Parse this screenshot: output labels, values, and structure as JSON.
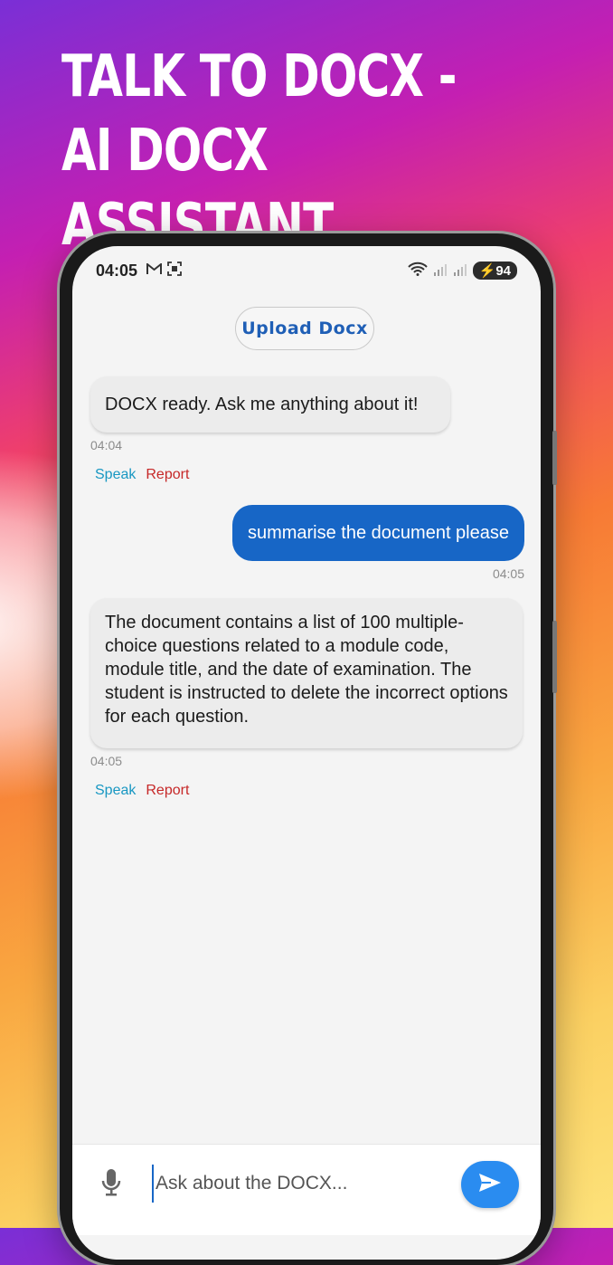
{
  "promo": {
    "title_line1": "TALK TO DOCX -",
    "title_line2": "AI DOCX ASSISTANT"
  },
  "status_bar": {
    "time": "04:05",
    "battery": "94",
    "icons": [
      "gmail-icon",
      "screenshot-icon",
      "wifi-icon",
      "signal-icon",
      "signal-icon",
      "battery-charging-icon"
    ]
  },
  "header": {
    "upload_label": "Upload Docx"
  },
  "messages": [
    {
      "sender": "bot",
      "text": "DOCX ready. Ask me anything about it!",
      "time": "04:04",
      "speak_label": "Speak",
      "report_label": "Report"
    },
    {
      "sender": "user",
      "text": "summarise the document please",
      "time": "04:05"
    },
    {
      "sender": "bot",
      "text": "The document contains a list of 100 multiple-choice questions related to a module code, module title, and the date of examination. The student is instructed to delete the incorrect options for each question.",
      "time": "04:05",
      "speak_label": "Speak",
      "report_label": "Report"
    }
  ],
  "composer": {
    "placeholder": "Ask about the DOCX...",
    "value": ""
  },
  "colors": {
    "user_bubble": "#1766c6",
    "bot_bubble": "#ececec",
    "speak": "#1897c2",
    "report": "#c62828",
    "send_button": "#2a8cf0",
    "upload_text": "#1f5fb6"
  }
}
